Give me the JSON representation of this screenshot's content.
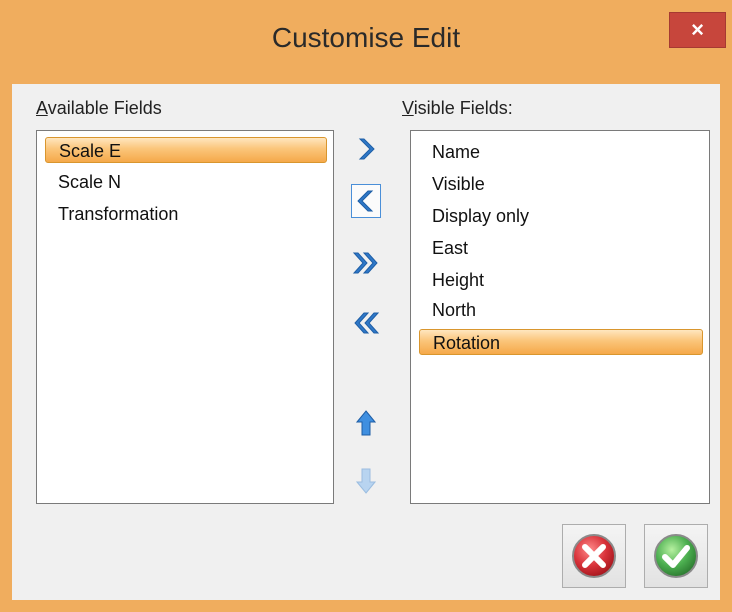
{
  "window": {
    "title": "Customise Edit",
    "close_glyph": "×",
    "frame_color": "#f0ad5e"
  },
  "available": {
    "label_accel": "A",
    "label_rest": "vailable Fields",
    "items": [
      {
        "label": "Scale E",
        "selected": true
      },
      {
        "label": "Scale N",
        "selected": false
      },
      {
        "label": "Transformation",
        "selected": false
      }
    ]
  },
  "visible": {
    "label_accel": "V",
    "label_rest": "isible Fields:",
    "items": [
      {
        "label": "Name",
        "selected": false
      },
      {
        "label": "Visible",
        "selected": false
      },
      {
        "label": "Display only",
        "selected": false
      },
      {
        "label": "East",
        "selected": false
      },
      {
        "label": "Height",
        "selected": false
      },
      {
        "label": "North",
        "selected": false
      },
      {
        "label": "Rotation",
        "selected": true
      }
    ]
  },
  "transfer_buttons": [
    {
      "icon": "chevron-right-icon",
      "enabled": true
    },
    {
      "icon": "chevron-left-icon",
      "enabled": true,
      "focused": true
    },
    {
      "icon": "double-chevron-right-icon",
      "enabled": true
    },
    {
      "icon": "double-chevron-left-icon",
      "enabled": true
    },
    {
      "icon": "arrow-up-icon",
      "enabled": true
    },
    {
      "icon": "arrow-down-icon",
      "enabled": false
    }
  ],
  "dialog_buttons": {
    "cancel_icon": "cancel-icon",
    "ok_icon": "ok-check-icon"
  },
  "colors": {
    "selection": "#fbc57a",
    "arrow_blue": "#2f78c8",
    "cancel_red": "#d8323a",
    "ok_green": "#4caf50"
  }
}
